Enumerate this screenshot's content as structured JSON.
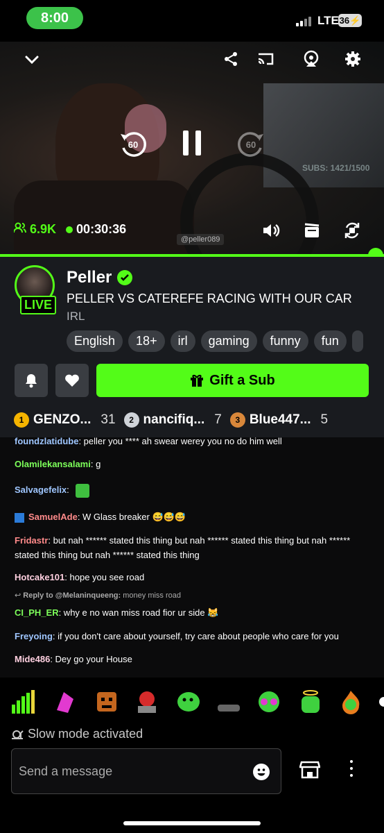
{
  "status_bar": {
    "time": "8:00",
    "network": "LTE",
    "battery": "36"
  },
  "player": {
    "subs_overlay": "SUBS: 1421/1500",
    "viewers": "6.9K",
    "elapsed": "00:30:36",
    "skip_back_seconds": "60",
    "skip_forward_seconds": "60",
    "overlay_handle": "@peller089",
    "progress": 1.0
  },
  "channel": {
    "name": "Peller",
    "live_badge": "LIVE",
    "stream_title": "PELLER VS CATEREFE RACING WITH OUR CAR",
    "category": "IRL",
    "tags": [
      "English",
      "18+",
      "irl",
      "gaming",
      "funny",
      "fun"
    ],
    "gift_label": "Gift a Sub"
  },
  "leaderboard": [
    {
      "rank": "1",
      "name": "GENZO...",
      "count": "31",
      "color": "#f5b400"
    },
    {
      "rank": "2",
      "name": "nancifiq...",
      "count": "7",
      "color": "#cfd3d8"
    },
    {
      "rank": "3",
      "name": "Blue447...",
      "count": "5",
      "color": "#d8873a"
    }
  ],
  "chat": [
    {
      "user": "foundzlatidube",
      "color": "#9fc6ff",
      "text": ": peller you **** ah swear werey you no do him well"
    },
    {
      "user": "Olamilekansalami",
      "color": "#7dff5a",
      "text": ": g"
    },
    {
      "user": "Salvagefelix",
      "color": "#9fc6ff",
      "text": ":"
    },
    {
      "user": "SamuelAde",
      "color": "#ff8a8a",
      "text": ": W Glass breaker 😅😅😅"
    },
    {
      "user": "Fridastr",
      "color": "#ff8a8a",
      "text": ": but nah ****** stated this thing but nah ****** stated this thing but nah ****** stated this thing but nah ****** stated this thing"
    },
    {
      "user": "Hotcake101",
      "color": "#ffd0e0",
      "text": ": hope you see road"
    },
    {
      "user": "CI_PH_ER",
      "color": "#7dff5a",
      "text": ": why e no wan miss road fior ur side 😹"
    },
    {
      "user": "Freyoing",
      "color": "#9fc6ff",
      "text": ": if you don't care about yourself, try care about people who care for you"
    },
    {
      "user": "Mide486",
      "color": "#ffd0e0",
      "text": ": Dey go your House"
    }
  ],
  "reply": {
    "prefix": "Reply to @Melaninqueeng:",
    "text": " money miss road"
  },
  "slow_mode": "Slow mode activated",
  "composer": {
    "placeholder": "Send a message"
  }
}
